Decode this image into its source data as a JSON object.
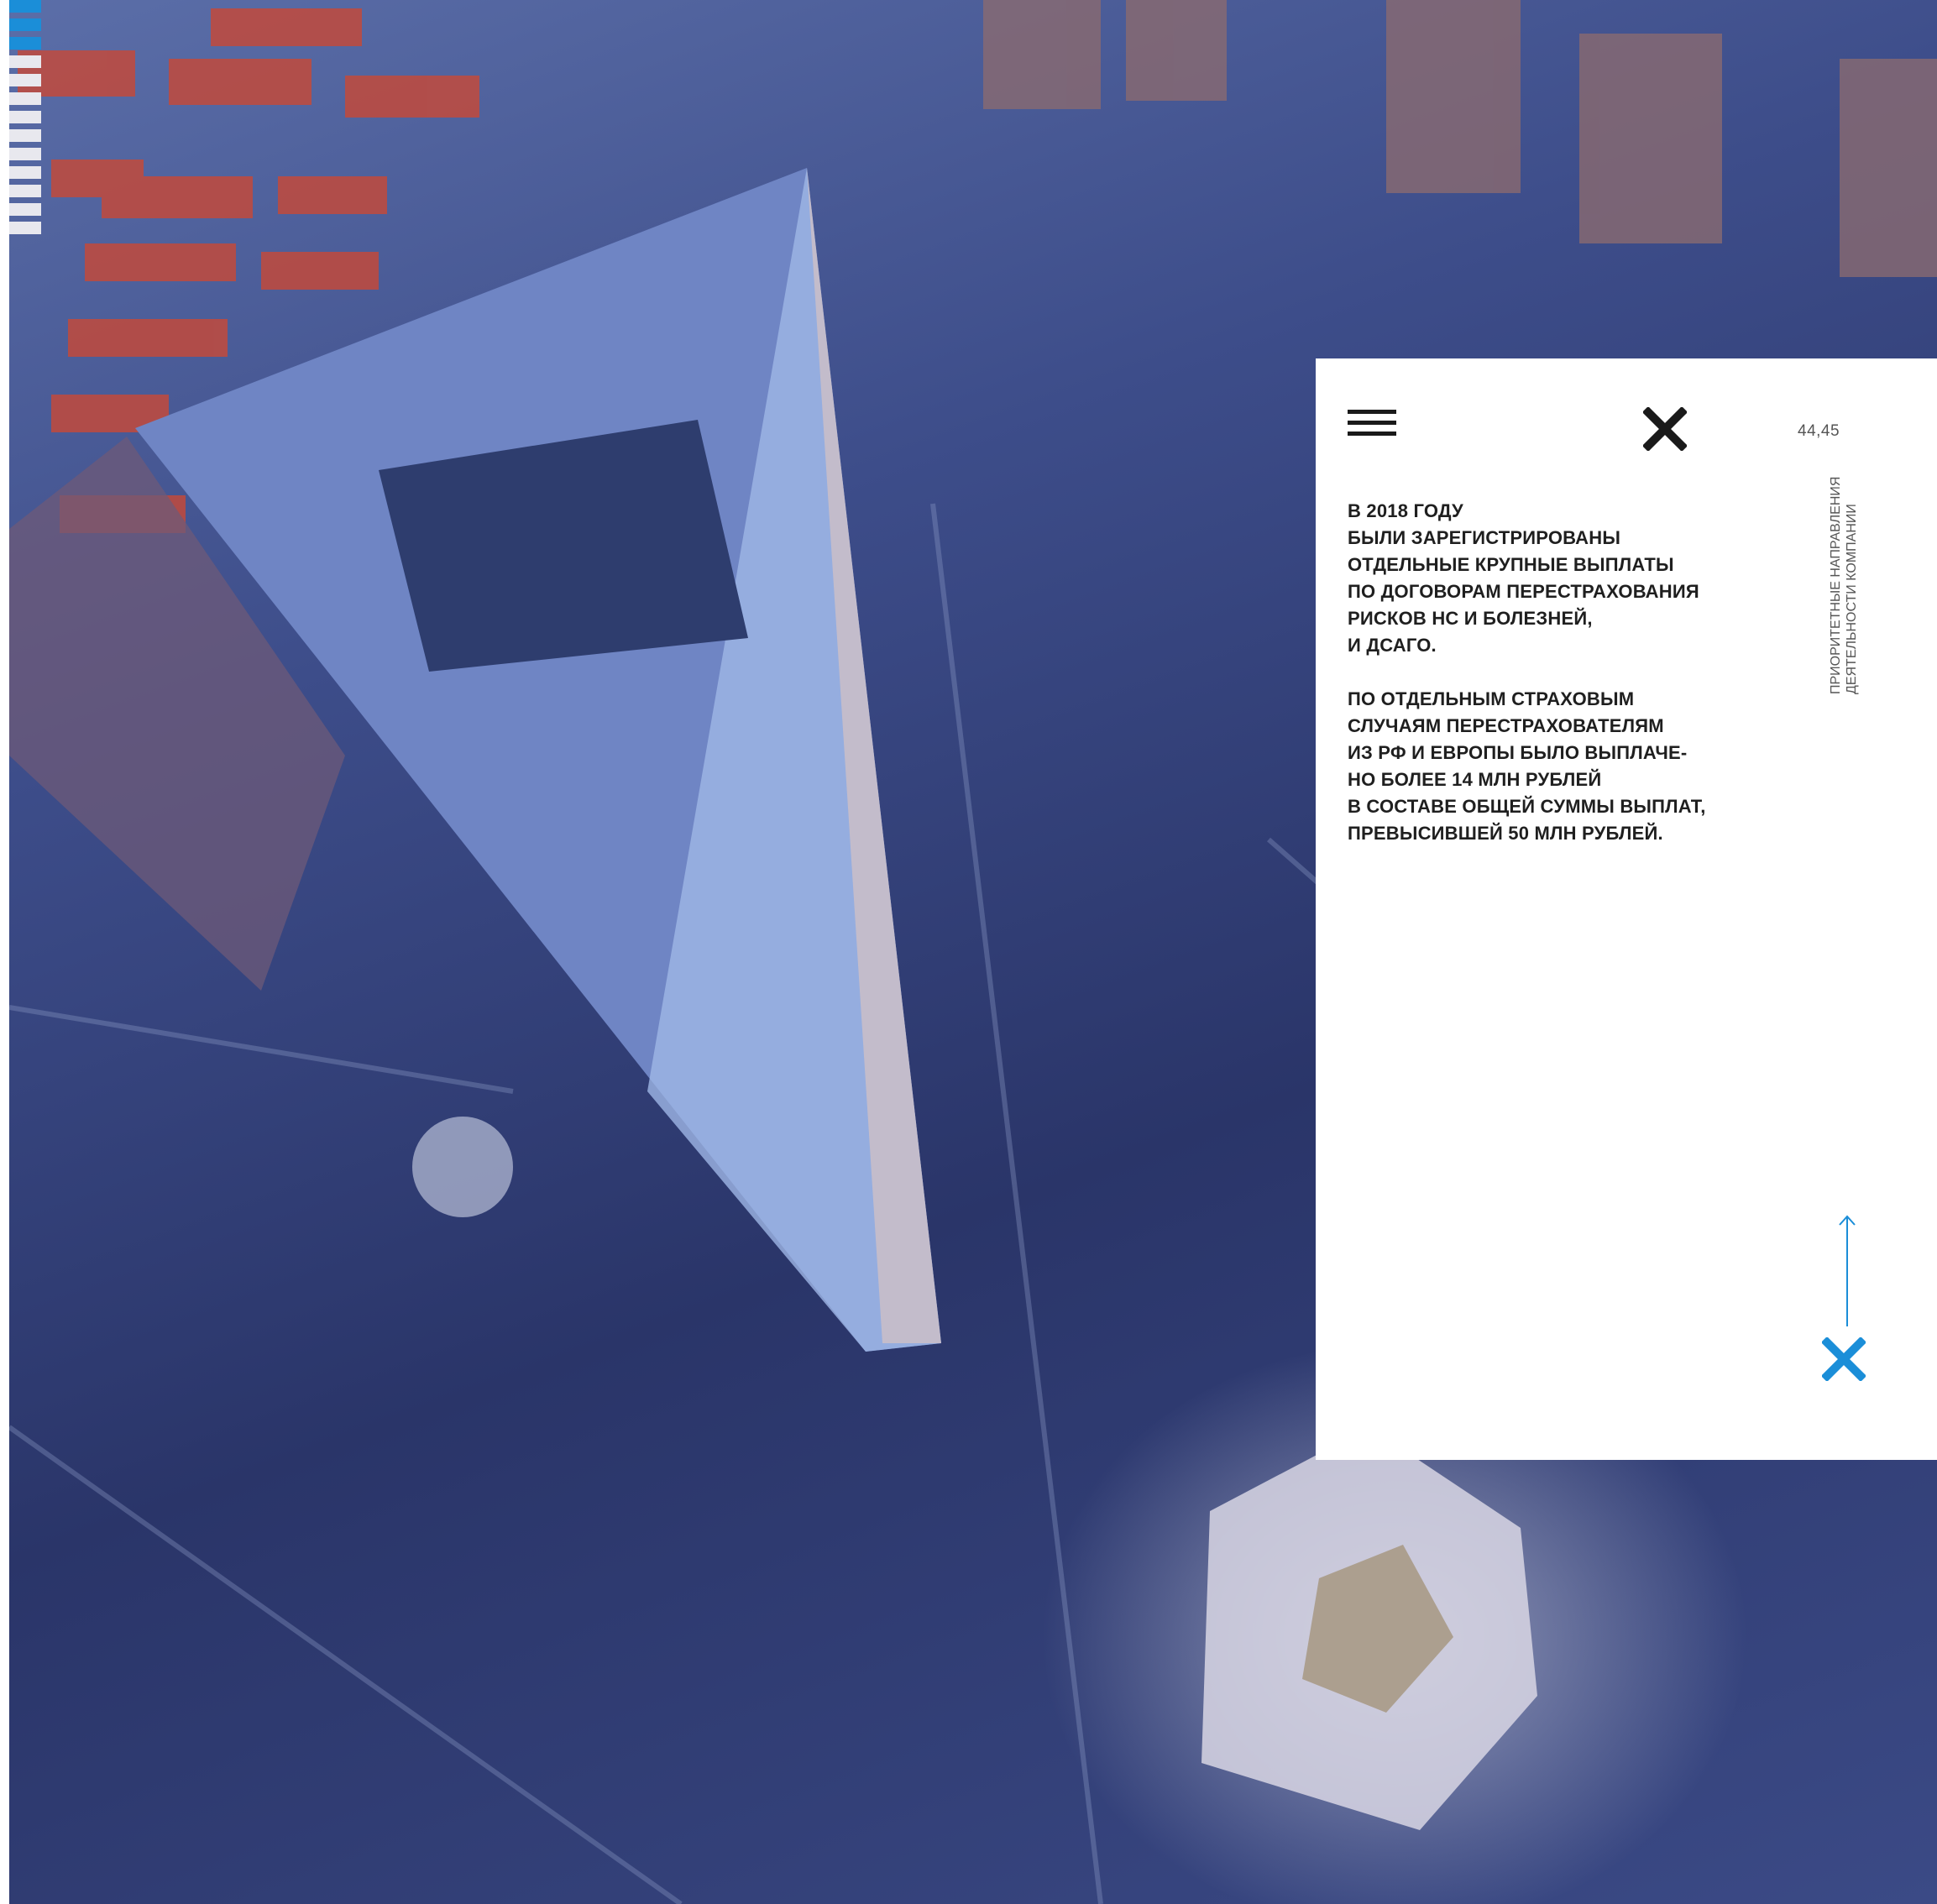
{
  "page": {
    "number": "44,45",
    "section_title": "ПРИОРИТЕТНЫЕ НАПРАВЛЕНИЯ\nДЕЯТЕЛЬНОСТИ КОМПАНИИ"
  },
  "panel": {
    "paragraph_1": "В 2018 году\nбыли зарегистрированы\nотдельные крупные выплаты\nпо договорам перестрахования\nрисков НС и болезней,\nи ДСАГО.",
    "paragraph_2": "По отдельным страховым\nслучаям перестрахователям\nиз РФ и Европы было выплаче-\nно более 14 млн рублей\nв составе общей суммы выплат,\nпревысившей 50 млн рублей."
  },
  "icons": {
    "menu": "hamburger-menu-icon",
    "close": "close-x-icon",
    "arrow": "arrow-up-icon",
    "brand_x": "brand-x-icon",
    "logo": "striped-logo-icon"
  },
  "colors": {
    "accent_blue": "#1b8ed8",
    "panel_bg": "#ffffff",
    "text_dark": "#1f1f1f"
  }
}
